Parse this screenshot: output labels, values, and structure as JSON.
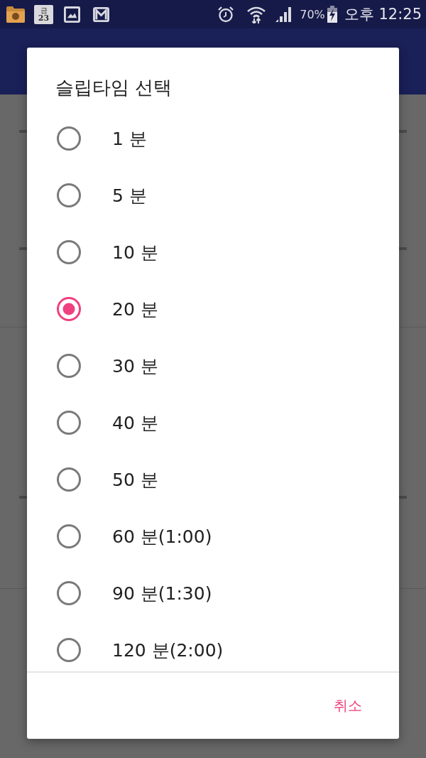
{
  "status_bar": {
    "calendar_weekday": "금",
    "calendar_date": "23",
    "battery": "70%",
    "time": "오후 12:25"
  },
  "dialog": {
    "title": "슬립타임 선택",
    "options": [
      {
        "label": "1 분",
        "selected": false
      },
      {
        "label": "5 분",
        "selected": false
      },
      {
        "label": "10 분",
        "selected": false
      },
      {
        "label": "20 분",
        "selected": true
      },
      {
        "label": "30 분",
        "selected": false
      },
      {
        "label": "40 분",
        "selected": false
      },
      {
        "label": "50 분",
        "selected": false
      },
      {
        "label": "60 분(1:00)",
        "selected": false
      },
      {
        "label": "90 분(1:30)",
        "selected": false
      },
      {
        "label": "120 분(2:00)",
        "selected": false
      }
    ],
    "buttons": [
      "취소"
    ]
  }
}
